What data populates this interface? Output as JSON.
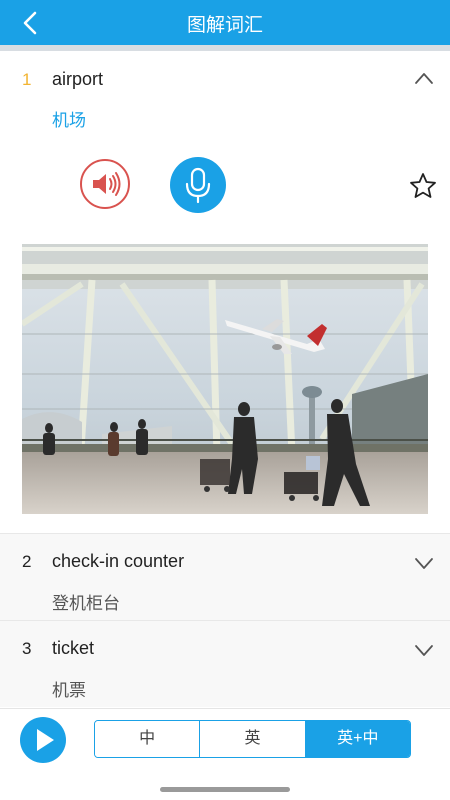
{
  "header": {
    "title": "图解词汇",
    "progress": 0.0,
    "colors": {
      "bar": "#1aa1e6",
      "progress": "#f2b431"
    }
  },
  "words": [
    {
      "index": "1",
      "en": "airport",
      "zh": "机场",
      "expanded": true,
      "starred": false
    },
    {
      "index": "2",
      "en": "check-in counter",
      "zh": "登机柜台",
      "expanded": false
    },
    {
      "index": "3",
      "en": "ticket",
      "zh": "机票",
      "expanded": false
    }
  ],
  "icons": {
    "back": "chevron-left-icon",
    "expand": "chevron-up-icon",
    "collapse": "chevron-down-icon",
    "speaker": "speaker-icon",
    "mic": "microphone-icon",
    "star": "star-outline-icon",
    "play": "play-icon"
  },
  "footer": {
    "modes": [
      "中",
      "英",
      "英+中"
    ],
    "selected_mode": "英+中"
  }
}
